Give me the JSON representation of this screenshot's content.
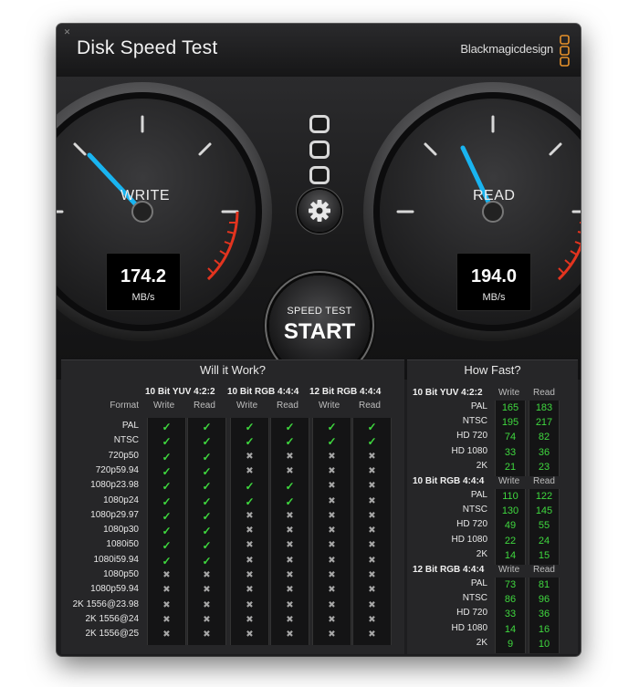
{
  "window": {
    "title": "Disk Speed Test",
    "brand": "Blackmagicdesign"
  },
  "gauges": {
    "write": {
      "label": "WRITE",
      "value": "174.2",
      "unit": "MB/s"
    },
    "read": {
      "label": "READ",
      "value": "194.0",
      "unit": "MB/s"
    }
  },
  "start_button": {
    "small": "SPEED TEST",
    "big": "START"
  },
  "will_it_work": {
    "title": "Will it Work?",
    "format_header": "Format",
    "groups": [
      "10 Bit YUV 4:2:2",
      "10 Bit RGB 4:4:4",
      "12 Bit RGB 4:4:4"
    ],
    "subheaders": [
      "Write",
      "Read"
    ],
    "formats": [
      "PAL",
      "NTSC",
      "720p50",
      "720p59.94",
      "1080p23.98",
      "1080p24",
      "1080p29.97",
      "1080p30",
      "1080i50",
      "1080i59.94",
      "1080p50",
      "1080p59.94",
      "2K 1556@23.98",
      "2K 1556@24",
      "2K 1556@25"
    ],
    "cells": [
      [
        1,
        1,
        1,
        1,
        1,
        1
      ],
      [
        1,
        1,
        1,
        1,
        1,
        1
      ],
      [
        1,
        1,
        0,
        0,
        0,
        0
      ],
      [
        1,
        1,
        0,
        0,
        0,
        0
      ],
      [
        1,
        1,
        1,
        1,
        0,
        0
      ],
      [
        1,
        1,
        1,
        1,
        0,
        0
      ],
      [
        1,
        1,
        0,
        0,
        0,
        0
      ],
      [
        1,
        1,
        0,
        0,
        0,
        0
      ],
      [
        1,
        1,
        0,
        0,
        0,
        0
      ],
      [
        1,
        1,
        0,
        0,
        0,
        0
      ],
      [
        0,
        0,
        0,
        0,
        0,
        0
      ],
      [
        0,
        0,
        0,
        0,
        0,
        0
      ],
      [
        0,
        0,
        0,
        0,
        0,
        0
      ],
      [
        0,
        0,
        0,
        0,
        0,
        0
      ],
      [
        0,
        0,
        0,
        0,
        0,
        0
      ]
    ],
    "colors": {
      "check": "#3fd83f",
      "cross": "#a6a6a6"
    }
  },
  "how_fast": {
    "title": "How Fast?",
    "groups": [
      {
        "name": "10 Bit YUV 4:2:2",
        "rows": [
          {
            "format": "PAL",
            "write": "165",
            "read": "183"
          },
          {
            "format": "NTSC",
            "write": "195",
            "read": "217"
          },
          {
            "format": "HD 720",
            "write": "74",
            "read": "82"
          },
          {
            "format": "HD 1080",
            "write": "33",
            "read": "36"
          },
          {
            "format": "2K",
            "write": "21",
            "read": "23"
          }
        ]
      },
      {
        "name": "10 Bit RGB 4:4:4",
        "rows": [
          {
            "format": "PAL",
            "write": "110",
            "read": "122"
          },
          {
            "format": "NTSC",
            "write": "130",
            "read": "145"
          },
          {
            "format": "HD 720",
            "write": "49",
            "read": "55"
          },
          {
            "format": "HD 1080",
            "write": "22",
            "read": "24"
          },
          {
            "format": "2K",
            "write": "14",
            "read": "15"
          }
        ]
      },
      {
        "name": "12 Bit RGB 4:4:4",
        "rows": [
          {
            "format": "PAL",
            "write": "73",
            "read": "81"
          },
          {
            "format": "NTSC",
            "write": "86",
            "read": "96"
          },
          {
            "format": "HD 720",
            "write": "33",
            "read": "36"
          },
          {
            "format": "HD 1080",
            "write": "14",
            "read": "16"
          },
          {
            "format": "2K",
            "write": "9",
            "read": "10"
          }
        ]
      }
    ],
    "subheaders": [
      "Write",
      "Read"
    ]
  },
  "icons": {
    "close": "close-icon",
    "gear": "gear-icon",
    "logo": "blackmagic-logo-icon",
    "check": "check-icon",
    "cross": "cross-icon"
  },
  "theme": {
    "needle": "#19b4f0",
    "redline": "#e3341f",
    "accent_green": "#3fd83f"
  }
}
